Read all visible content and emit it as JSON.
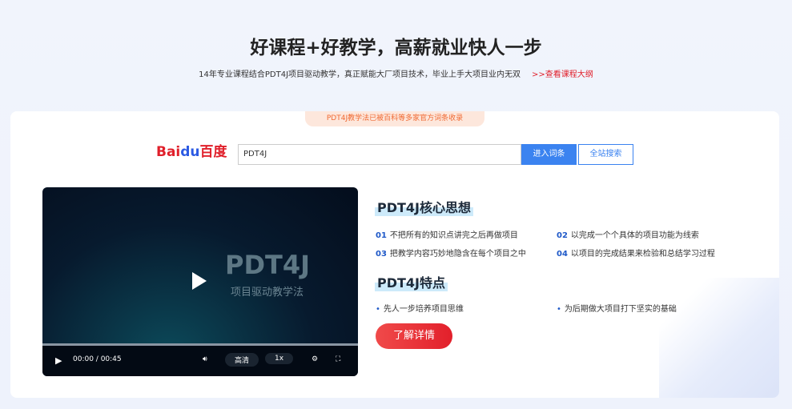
{
  "header": {
    "title": "好课程+好教学，高薪就业快人一步",
    "subtitle": "14年专业课程结合PDT4J项目驱动教学，真正赋能大厂项目技术，毕业上手大项目业内无双",
    "outline_link": ">>查看课程大纲"
  },
  "badge": "PDT4J教学法已被百科等多家官方词条收录",
  "search": {
    "logo": "Bai百度",
    "logo_paw": "du",
    "value": "PDT4J",
    "enter_label": "进入词条",
    "site_label": "全站搜索"
  },
  "video": {
    "title": "PDT4J",
    "subtitle": "项目驱动教学法",
    "time": "00:00 / 00:45",
    "quality": "高清",
    "speed": "1x",
    "progress": 0
  },
  "core": {
    "heading": "PDT4J核心思想",
    "items": [
      {
        "num": "01",
        "text": "不把所有的知识点讲完之后再做项目"
      },
      {
        "num": "02",
        "text": "以完成一个个具体的项目功能为线索"
      },
      {
        "num": "03",
        "text": "把教学内容巧妙地隐含在每个项目之中"
      },
      {
        "num": "04",
        "text": "以项目的完成结果来检验和总结学习过程"
      }
    ]
  },
  "features": {
    "heading": "PDT4J特点",
    "items": [
      "先人一步培养项目思维",
      "为后期做大项目打下坚实的基础"
    ]
  },
  "cta": "了解详情"
}
